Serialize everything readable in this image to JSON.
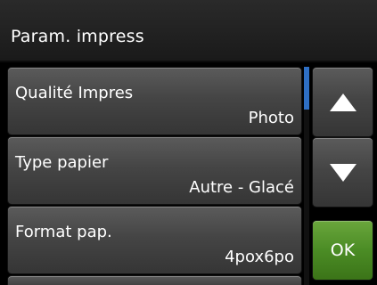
{
  "header": {
    "title": "Param. impress"
  },
  "settings": {
    "items": [
      {
        "label": "Qualité Impres",
        "value": "Photo"
      },
      {
        "label": "Type papier",
        "value": "Autre - Glacé"
      },
      {
        "label": "Format pap.",
        "value": "4pox6po"
      }
    ]
  },
  "buttons": {
    "up_icon": "triangle-up-icon",
    "down_icon": "triangle-down-icon",
    "ok_label": "OK"
  },
  "colors": {
    "header_bg": "#222222",
    "item_bg": "#454545",
    "scroll_thumb": "#2e6fc4",
    "ok_button": "#4b8c25",
    "text": "#ffffff"
  }
}
